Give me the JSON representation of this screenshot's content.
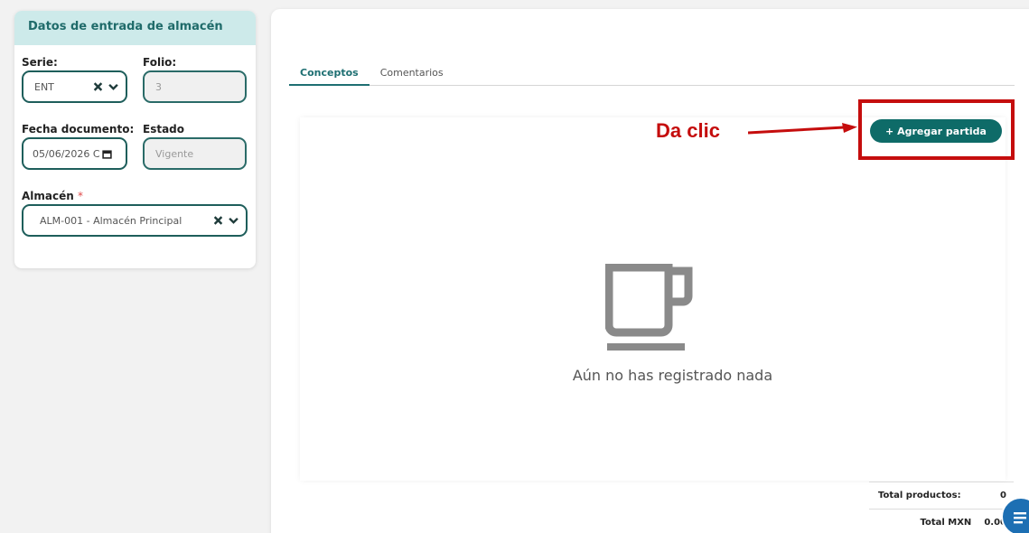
{
  "left_card": {
    "title": "Datos de entrada de almacén",
    "serie": {
      "label": "Serie:",
      "value": "ENT"
    },
    "folio": {
      "label": "Folio:",
      "value": "3"
    },
    "fecha": {
      "label": "Fecha documento:",
      "value": "05/06/2026 C"
    },
    "estado": {
      "label": "Estado",
      "value": "Vigente"
    },
    "almacen": {
      "label": "Almacén",
      "required_mark": "*",
      "value": "ALM-001 - Almacén Principal"
    }
  },
  "tabs": [
    {
      "label": "Conceptos",
      "active": true
    },
    {
      "label": "Comentarios",
      "active": false
    }
  ],
  "add_button": {
    "label": "+ Agregar partida"
  },
  "annotation": {
    "text": "Da clic"
  },
  "empty_state": {
    "message": "Aún no has registrado nada"
  },
  "totals": {
    "productos_label": "Total productos:",
    "productos_value": "0",
    "mxn_label": "Total MXN",
    "mxn_value": "0.00"
  },
  "colors": {
    "accent": "#0e6b68",
    "annotation": "#c50d0d",
    "header_bg": "#cdeaea"
  },
  "icons": [
    "clear-x-icon",
    "chevron-down-icon",
    "calendar-icon",
    "coffee-cup-icon",
    "chat-icon"
  ]
}
